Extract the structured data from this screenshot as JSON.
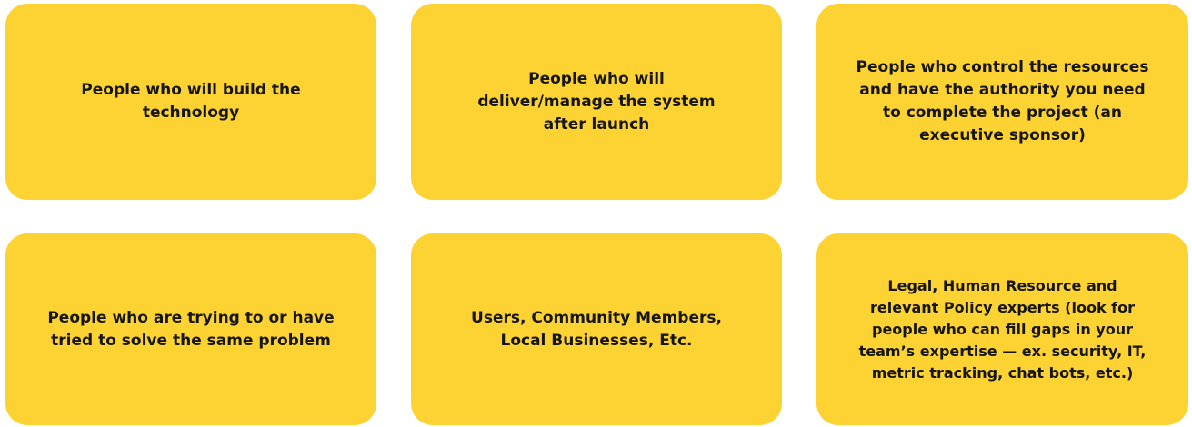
{
  "colors": {
    "card_background": "#fdd233",
    "text": "#161616",
    "page_background": "#ffffff"
  },
  "cards": [
    {
      "text": "People who will build the technology"
    },
    {
      "text": "People who will deliver/manage the system after launch"
    },
    {
      "text": "People who control the resources and have the authority you need to complete the project (an executive sponsor)"
    },
    {
      "text": "People who are trying to or have tried to solve the same problem"
    },
    {
      "text": "Users, Community Members, Local Businesses, Etc."
    },
    {
      "text": "Legal, Human Resource and relevant Policy experts (look for people who can fill gaps in your team’s expertise — ex. security, IT, metric tracking, chat bots, etc.)"
    }
  ]
}
